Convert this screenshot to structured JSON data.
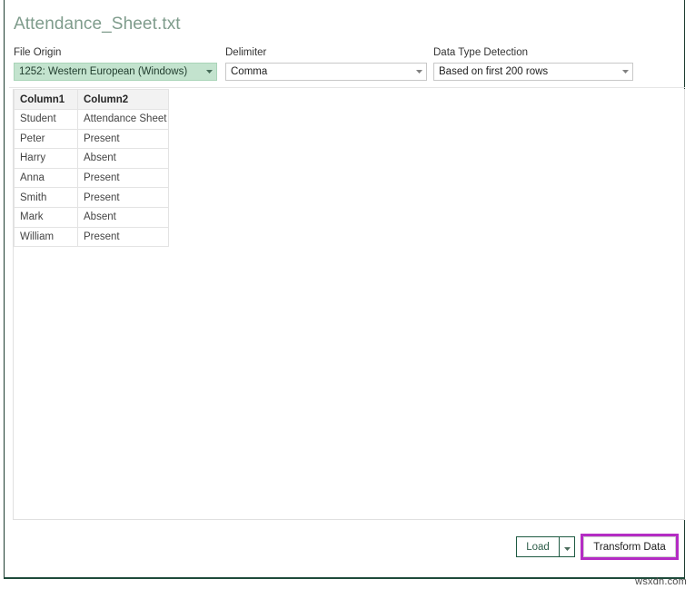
{
  "window": {
    "file_title": "Attendance_Sheet.txt"
  },
  "options": {
    "file_origin": {
      "label": "File Origin",
      "value": "1252: Western European (Windows)",
      "highlight_color": "#c3e3ce"
    },
    "delimiter": {
      "label": "Delimiter",
      "value": "Comma"
    },
    "data_type_detection": {
      "label": "Data Type Detection",
      "value": "Based on first 200 rows"
    }
  },
  "preview": {
    "columns": [
      "Column1",
      "Column2"
    ],
    "rows": [
      [
        "Student",
        "Attendance Sheet"
      ],
      [
        "Peter",
        "Present"
      ],
      [
        "Harry",
        "Absent"
      ],
      [
        "Anna",
        "Present"
      ],
      [
        "Smith",
        "Present"
      ],
      [
        "Mark",
        "Absent"
      ],
      [
        "William",
        "Present"
      ]
    ]
  },
  "footer": {
    "load_label": "Load",
    "load_dropdown_icon": "chevron-down-icon",
    "transform_label": "Transform Data",
    "transform_highlight_color": "#b42cc4"
  },
  "watermark": {
    "text": "wsxdn.com"
  }
}
